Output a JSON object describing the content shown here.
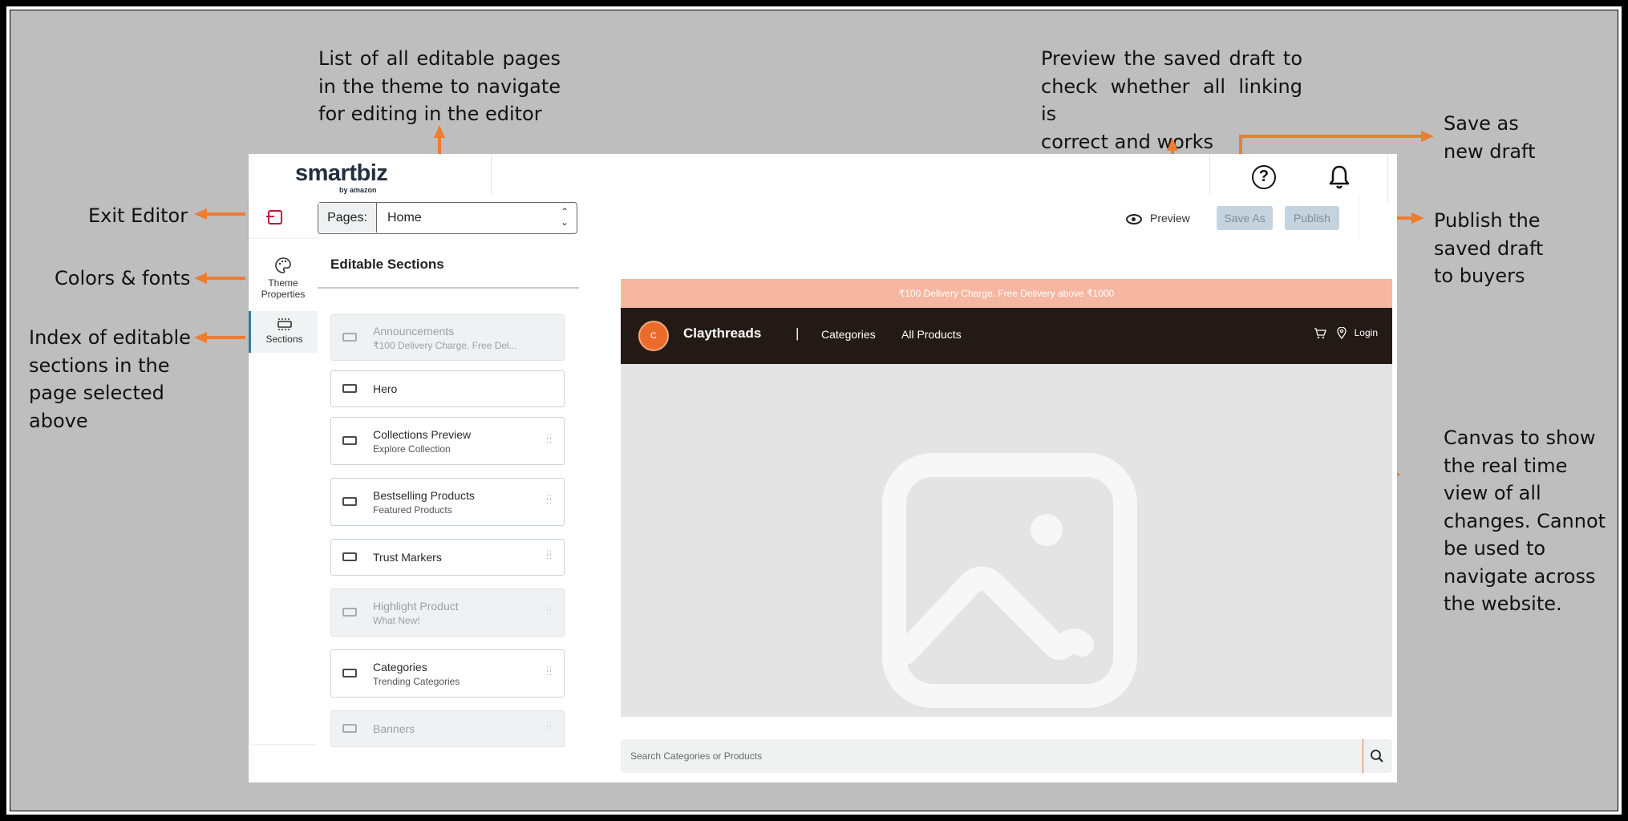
{
  "annotations": {
    "pages_list": [
      "List of all editable pages",
      "in the theme to navigate",
      "for editing in the editor"
    ],
    "preview": [
      "Preview the saved draft to",
      "check whether all linking is",
      "correct and works"
    ],
    "save_as": [
      "Save as",
      "new draft"
    ],
    "exit_editor": "Exit Editor",
    "publish": [
      "Publish the",
      "saved draft",
      "to buyers"
    ],
    "colors_fonts": "Colors & fonts",
    "index": [
      "Index of editable",
      "sections in the",
      "page selected",
      "above"
    ],
    "canvas": [
      "Canvas to show",
      "the real time",
      "view of all",
      "changes. Cannot",
      "be used to",
      "navigate across",
      "the website."
    ]
  },
  "colors": {
    "annotation_arrow": "#ed7d31",
    "exit_icon": "#c4143b",
    "announce_bg": "#f5b7a1",
    "store_nav_bg": "#231a16",
    "store_avatar": "#ec6b2b",
    "disabled_button": "#c5d3de"
  },
  "topbar": {
    "logo": "smartbiz",
    "logo_sub": "by amazon",
    "help_icon": "help-icon",
    "bell_icon": "bell-icon"
  },
  "editorbar": {
    "pages_label": "Pages:",
    "pages_value": "Home",
    "preview_label": "Preview",
    "save_as_label": "Save As",
    "publish_label": "Publish"
  },
  "rail": {
    "theme_label_1": "Theme",
    "theme_label_2": "Properties",
    "sections_label": "Sections"
  },
  "panel": {
    "title": "Editable Sections",
    "sections": [
      {
        "title": "Announcements",
        "subtitle": "₹100 Delivery Charge. Free Del...",
        "disabled": true
      },
      {
        "title": "Hero",
        "subtitle": "",
        "disabled": false
      },
      {
        "title": "Collections Preview",
        "subtitle": "Explore Collection",
        "disabled": false
      },
      {
        "title": "Bestselling Products",
        "subtitle": "Featured Products",
        "disabled": false
      },
      {
        "title": "Trust Markers",
        "subtitle": "",
        "disabled": false
      },
      {
        "title": "Highlight Product",
        "subtitle": "What New!",
        "disabled": true
      },
      {
        "title": "Categories",
        "subtitle": "Trending Categories",
        "disabled": false
      },
      {
        "title": "Banners",
        "subtitle": "",
        "disabled": true
      }
    ]
  },
  "store": {
    "announcement": "₹100 Delivery Charge. Free Delivery above ₹1000",
    "avatar_letter": "C",
    "name": "Claythreads",
    "separator": "|",
    "nav_categories": "Categories",
    "nav_all_products": "All Products",
    "login": "Login",
    "search_placeholder": "Search Categories or Products"
  }
}
